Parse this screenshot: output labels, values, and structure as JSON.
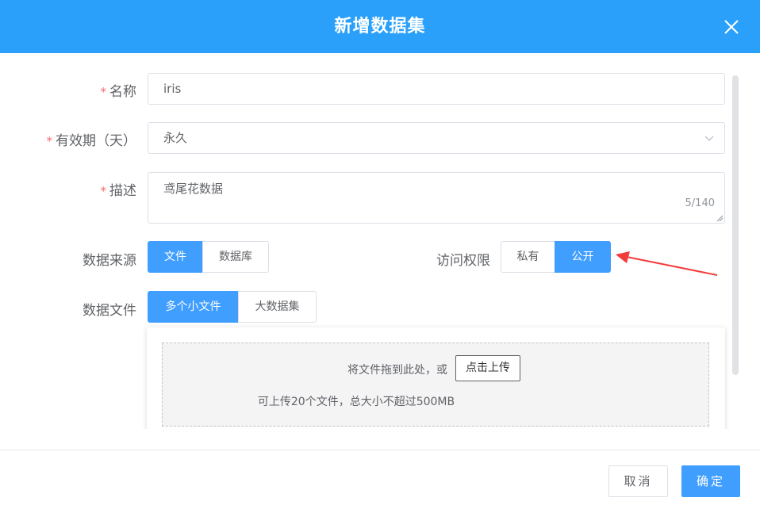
{
  "dialog": {
    "title": "新增数据集",
    "close_icon": "close-icon"
  },
  "form": {
    "name": {
      "label": "名称",
      "required_mark": "*",
      "value": "iris"
    },
    "validity": {
      "label": "有效期（天）",
      "required_mark": "*",
      "value": "永久"
    },
    "description": {
      "label": "描述",
      "required_mark": "*",
      "value": "鸢尾花数据",
      "counter": "5/140"
    },
    "source": {
      "label": "数据来源",
      "options": [
        "文件",
        "数据库"
      ],
      "selected": "文件"
    },
    "access": {
      "label": "访问权限",
      "options": [
        "私有",
        "公开"
      ],
      "selected": "公开"
    },
    "files": {
      "label": "数据文件",
      "options": [
        "多个小文件",
        "大数据集"
      ],
      "selected": "多个小文件"
    }
  },
  "upload": {
    "drop_hint": "将文件拖到此处，或",
    "pick_button": "点击上传",
    "limit_hint": "可上传20个文件，总大小不超过500MB"
  },
  "footer": {
    "cancel_label": "取消",
    "confirm_label": "确定"
  },
  "colors": {
    "header": "#2aa0fb",
    "primary": "#409eff",
    "required": "#f56c6c",
    "annotation_arrow": "#f23c3c"
  }
}
